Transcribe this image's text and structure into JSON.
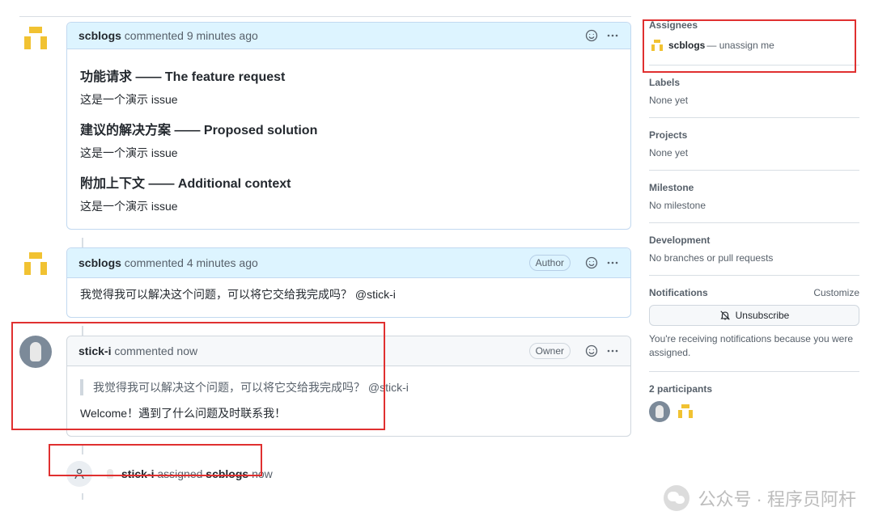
{
  "comments": [
    {
      "author": "scblogs",
      "time_prefix": "commented",
      "time": "9 minutes ago",
      "badges": [],
      "body": {
        "h1": "功能请求 —— The feature request",
        "p1": "这是一个演示 issue",
        "h2": "建议的解决方案 —— Proposed solution",
        "p2": "这是一个演示 issue",
        "h3": "附加上下文 —— Additional context",
        "p3": "这是一个演示 issue"
      }
    },
    {
      "author": "scblogs",
      "time_prefix": "commented",
      "time": "4 minutes ago",
      "badges": [
        "Author"
      ],
      "body": {
        "p1": "我觉得我可以解决这个问题，可以将它交给我完成吗？ @stick-i"
      }
    },
    {
      "author": "stick-i",
      "time_prefix": "commented",
      "time": "now",
      "badges": [
        "Owner"
      ],
      "body": {
        "quote": "我觉得我可以解决这个问题，可以将它交给我完成吗？ @stick-i",
        "p1": "Welcome！遇到了什么问题及时联系我！"
      }
    }
  ],
  "timeline_event": {
    "actor": "stick-i",
    "action": "assigned",
    "target": "scblogs",
    "time": "now"
  },
  "sidebar": {
    "assignees": {
      "title": "Assignees",
      "name": "scblogs",
      "sep": "—",
      "link": "unassign me"
    },
    "labels": {
      "title": "Labels",
      "value": "None yet"
    },
    "projects": {
      "title": "Projects",
      "value": "None yet"
    },
    "milestone": {
      "title": "Milestone",
      "value": "No milestone"
    },
    "development": {
      "title": "Development",
      "value": "No branches or pull requests"
    },
    "notifications": {
      "title": "Notifications",
      "customize": "Customize",
      "button": "Unsubscribe",
      "note": "You're receiving notifications because you were assigned."
    },
    "participants": {
      "title": "2 participants"
    }
  },
  "watermark": "公众号 · 程序员阿杆"
}
